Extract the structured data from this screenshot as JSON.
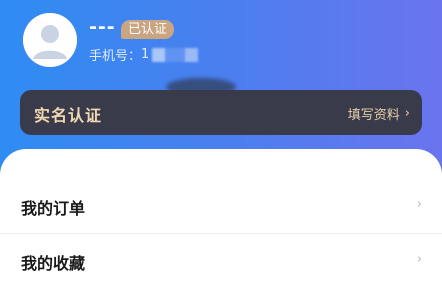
{
  "profile": {
    "username": "---",
    "badge": "已认证",
    "phone_label": "手机号：",
    "phone_visible": "1"
  },
  "verify_card": {
    "title": "实名认证",
    "action": "填写资料",
    "chevron": "›"
  },
  "menu": {
    "items": [
      {
        "label": "我的订单",
        "chevron": "›"
      },
      {
        "label": "我的收藏",
        "chevron": "›"
      }
    ]
  },
  "colors": {
    "header_gradient": [
      "#2f8cf2",
      "#6a74ee"
    ],
    "badge": "#c9a582",
    "verify_bg": "#3a3b4a",
    "verify_text": "#f3d9b3"
  }
}
